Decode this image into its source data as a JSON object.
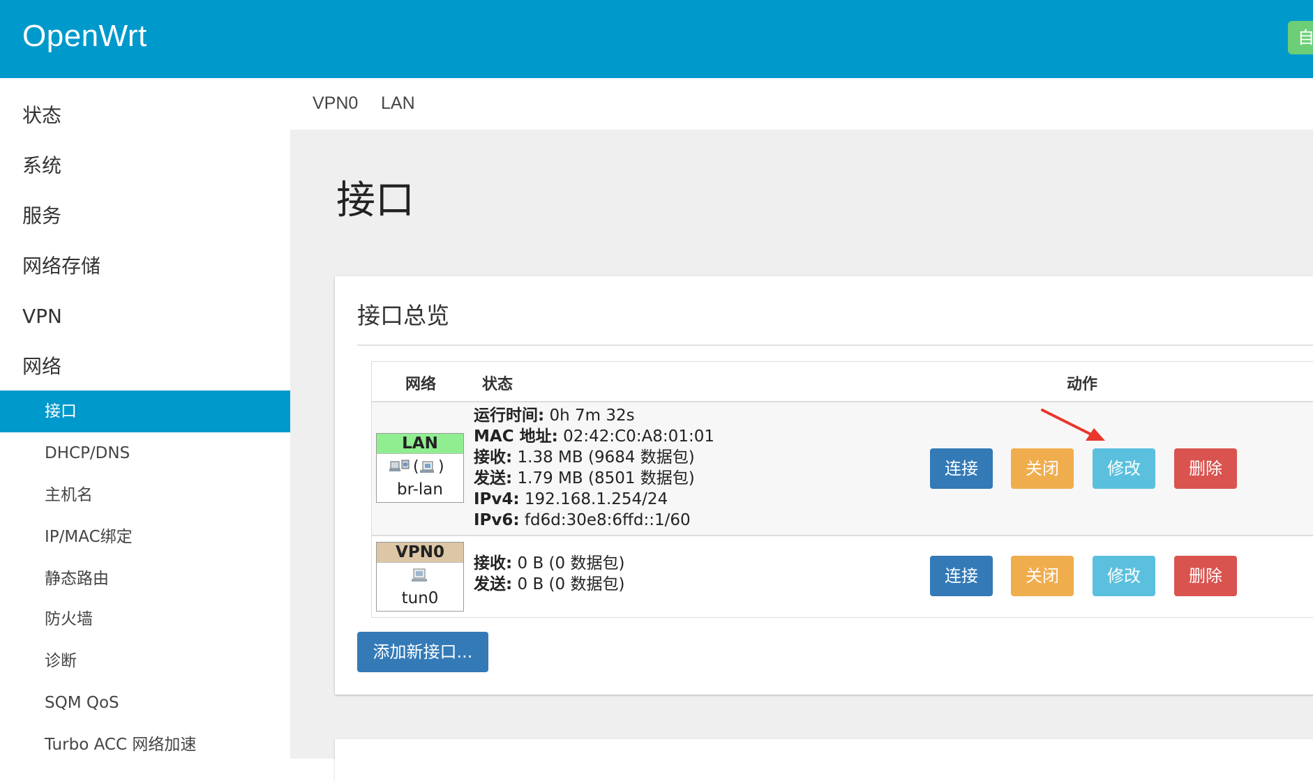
{
  "header": {
    "brand": "OpenWrt",
    "right_button": "自"
  },
  "sidebar": {
    "top_items": [
      "状态",
      "系统",
      "服务",
      "网络存储",
      "VPN",
      "网络"
    ],
    "sub_items": [
      {
        "label": "接口",
        "active": true
      },
      {
        "label": "DHCP/DNS",
        "active": false
      },
      {
        "label": "主机名",
        "active": false
      },
      {
        "label": "IP/MAC绑定",
        "active": false
      },
      {
        "label": "静态路由",
        "active": false
      },
      {
        "label": "防火墙",
        "active": false
      },
      {
        "label": "诊断",
        "active": false
      },
      {
        "label": "SQM QoS",
        "active": false
      },
      {
        "label": "Turbo ACC 网络加速",
        "active": false
      }
    ]
  },
  "tabs": [
    "VPN0",
    "LAN"
  ],
  "page": {
    "title": "接口"
  },
  "panel": {
    "title": "接口总览",
    "columns": {
      "network": "网络",
      "status": "状态",
      "actions": "动作"
    },
    "rows": [
      {
        "name": "LAN",
        "name_color": "#90ee90",
        "device": "br-lan",
        "icons": "bridge-icons",
        "status": [
          {
            "k": "运行时间:",
            "v": " 0h 7m 32s"
          },
          {
            "k": "MAC 地址:",
            "v": " 02:42:C0:A8:01:01"
          },
          {
            "k": "接收:",
            "v": " 1.38 MB (9684 数据包)"
          },
          {
            "k": "发送:",
            "v": " 1.79 MB (8501 数据包)"
          },
          {
            "k": "IPv4:",
            "v": " 192.168.1.254/24"
          },
          {
            "k": "IPv6:",
            "v": " fd6d:30e8:6ffd::1/60"
          }
        ]
      },
      {
        "name": "VPN0",
        "name_color": "#dcc6a6",
        "device": "tun0",
        "icons": "tunnel-icon",
        "status": [
          {
            "k": "接收:",
            "v": " 0 B (0 数据包)"
          },
          {
            "k": "发送:",
            "v": " 0 B (0 数据包)"
          }
        ]
      }
    ],
    "actions": {
      "connect": "连接",
      "stop": "关闭",
      "edit": "修改",
      "delete": "删除"
    },
    "add_button": "添加新接口..."
  },
  "colors": {
    "header": "#0099cc",
    "connect": "#337ab7",
    "stop": "#f0ad4e",
    "edit": "#5bc0de",
    "delete": "#d9534f",
    "annotation_arrow": "#e8372c"
  }
}
